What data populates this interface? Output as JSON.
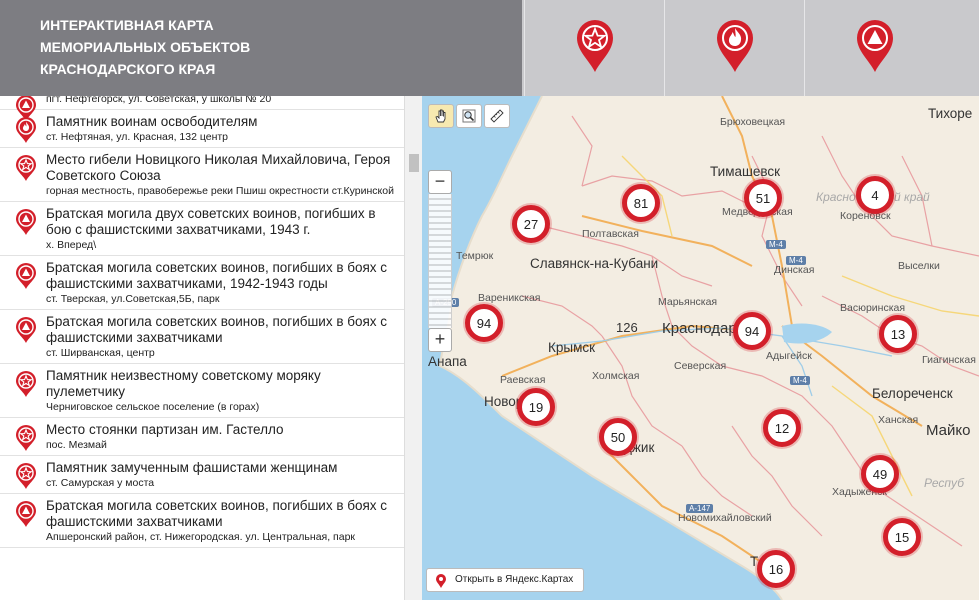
{
  "header": {
    "title": "ИНТЕРАКТИВНАЯ КАРТА\nМЕМОРИАЛЬНЫХ ОБЪЕКТОВ\nКРАСНОДАРСКОГО КРАЯ",
    "filters": [
      {
        "icon": "star-pin-icon"
      },
      {
        "icon": "flame-pin-icon"
      },
      {
        "icon": "triangle-pin-icon"
      }
    ],
    "accent_color": "#d31f2a"
  },
  "list": [
    {
      "title": "",
      "address": "пгт. Нефтегорск, ул. Советская, у школы № 20",
      "icon": "triangle-pin-icon"
    },
    {
      "title": "Памятник воинам освободителям",
      "address": "ст. Нефтяная, ул. Красная, 132 центр",
      "icon": "flame-pin-icon"
    },
    {
      "title": "Место гибели Новицкого Николая Михайловича, Героя Советского Союза",
      "address": "горная местность, правобережье реки Пшиш окрестности ст.Куринской",
      "icon": "star-pin-icon"
    },
    {
      "title": "Братская могила двух советских воинов, погибших в бою с фашистскими захватчиками, 1943 г.",
      "address": "х. Вперед\\",
      "icon": "triangle-pin-icon"
    },
    {
      "title": "Братская могила советских воинов, погибших в боях с фашистскими захватчиками, 1942-1943 годы",
      "address": "ст. Тверская, ул.Советская,5Б, парк",
      "icon": "triangle-pin-icon"
    },
    {
      "title": "Братская могила советских воинов, погибших в боях с фашистскими захватчиками",
      "address": "ст. Ширванская, центр",
      "icon": "triangle-pin-icon"
    },
    {
      "title": "Памятник неизвестному советскому моряку пулеметчику",
      "address": "Черниговское сельское поселение (в горах)",
      "icon": "star-pin-icon"
    },
    {
      "title": "Место стоянки партизан им. Гастелло",
      "address": "пос. Мезмай",
      "icon": "star-pin-icon"
    },
    {
      "title": "Памятник замученным фашистами женщинам",
      "address": "ст. Самурская у моста",
      "icon": "star-pin-icon"
    },
    {
      "title": "Братская могила советских воинов, погибших в боях с фашистскими захватчиками",
      "address": "Апшеронский район, ст. Нижегородская. ул. Центральная, парк",
      "icon": "triangle-pin-icon"
    }
  ],
  "map": {
    "clusters": [
      "27",
      "81",
      "51",
      "4",
      "94",
      "94",
      "13",
      "19",
      "50",
      "12",
      "49",
      "15",
      "16"
    ],
    "labels": {
      "bryukhovetskaya": "Брюховецкая",
      "tikhoretsk": "Тихоре",
      "timashevsk": "Тимашевск",
      "medvedovskaya": "Медведовская",
      "krasnodar_reservoir": "Краснодарский край",
      "korenovsk": "Кореновск",
      "poltavskaya": "Полтавская",
      "slavyansk": "Славянск-на-Кубани",
      "dinskaya": "Динская",
      "vyselki": "Выселки",
      "temryuk": "Темрюк",
      "maryanskaya": "Марьянская",
      "varenikovskaya": "Вареникская",
      "vasyurinskaya": "Васюринская",
      "krasnodar": "Краснодар",
      "anapa": "Анапа",
      "krymsk": "Крымск",
      "adygeysk": "Адыгейск",
      "severskaya": "Северская",
      "raevskaya": "Раевская",
      "kholmskaya": "Холмская",
      "novorossiysk": "Новоросс",
      "giaginskaya": "Гиагинская",
      "belorechensk": "Белореченск",
      "khanskaya": "Ханская",
      "maykop": "Майко",
      "respublika": "Респуб",
      "gelendzhik": "Гелен",
      "gelendzhik_tail": "джик",
      "khadyzhensk": "Хадыженск",
      "novomikhaylovsky": "Новомихайловский",
      "n126": "126",
      "tuapse": "Т"
    },
    "roads": [
      "М-4",
      "М-4",
      "А-290",
      "М-4",
      "А-147"
    ],
    "open_yandex": "Открыть в Яндекс.Картах",
    "tools": [
      "hand-tool-icon",
      "magnifier-tool-icon",
      "ruler-tool-icon"
    ]
  }
}
